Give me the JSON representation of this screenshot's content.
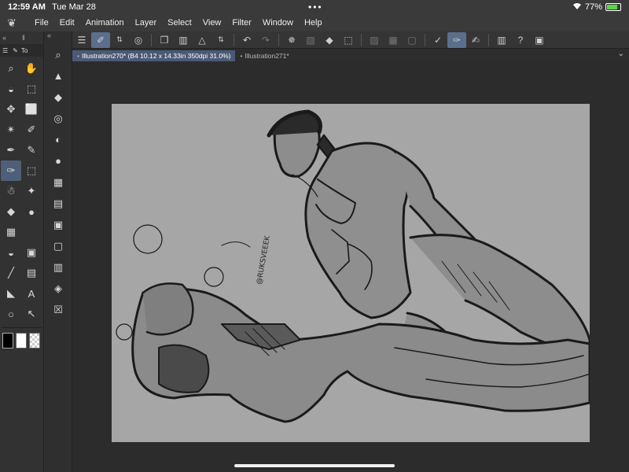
{
  "status": {
    "time": "12:59 AM",
    "date": "Tue Mar 28",
    "dots": "•••",
    "wifi_icon": "wifi-icon",
    "battery": "77%",
    "battery_level": 0.77
  },
  "menu": {
    "logo": "app-logo",
    "items": [
      "File",
      "Edit",
      "Animation",
      "Layer",
      "Select",
      "View",
      "Filter",
      "Window",
      "Help"
    ]
  },
  "toolbar": {
    "buttons": [
      "menu-icon",
      "brush-size-icon",
      "stepper-icon",
      "record-icon",
      "new-file-icon",
      "open-icon",
      "save-icon",
      "stepper-icon",
      "undo-icon",
      "redo-icon",
      "loading-icon",
      "transform-icon",
      "fill-icon",
      "crop-icon",
      "clear-icon",
      "layer-off-icon",
      "square-icon",
      "stroke-icon",
      "brush-icon",
      "pen-icon",
      "sidebar-icon",
      "help-icon",
      "settings-icon"
    ]
  },
  "tabs": {
    "items": [
      {
        "label": "Illustration270* (B4 10.12 x 14.33in 350dpi 31.0%)",
        "active": true
      },
      {
        "label": "Illustration271*",
        "active": false
      }
    ]
  },
  "left_panel": {
    "tab_label": "To",
    "tools": [
      {
        "icon": "zoom-icon",
        "glyph": "⌕"
      },
      {
        "icon": "hand-icon",
        "glyph": "✋"
      },
      {
        "icon": "fill-bucket-icon",
        "glyph": "◒"
      },
      {
        "icon": "object-select-icon",
        "glyph": "⬚"
      },
      {
        "icon": "move-icon",
        "glyph": "✥"
      },
      {
        "icon": "selection-rect-icon",
        "glyph": "⬜"
      },
      {
        "icon": "magic-wand-icon",
        "glyph": "✴"
      },
      {
        "icon": "eyedropper-icon",
        "glyph": "✐"
      },
      {
        "icon": "pen-icon",
        "glyph": "✒"
      },
      {
        "icon": "pencil-icon",
        "glyph": "✎"
      },
      {
        "icon": "brush-icon",
        "glyph": "✑"
      },
      {
        "icon": "marquee-icon",
        "glyph": "⬚"
      },
      {
        "icon": "airbrush-icon",
        "glyph": "☃"
      },
      {
        "icon": "sparkle-icon",
        "glyph": "✦"
      },
      {
        "icon": "eraser-icon",
        "glyph": "◆"
      },
      {
        "icon": "blend-icon",
        "glyph": "●"
      },
      {
        "icon": "frame-icon",
        "glyph": "▦"
      },
      {
        "icon": "empty-icon",
        "glyph": ""
      },
      {
        "icon": "fill-icon",
        "glyph": "◒"
      },
      {
        "icon": "gradient-icon",
        "glyph": "▣"
      },
      {
        "icon": "line-icon",
        "glyph": "╱"
      },
      {
        "icon": "panel-icon",
        "glyph": "▤"
      },
      {
        "icon": "ruler-icon",
        "glyph": "◣"
      },
      {
        "icon": "text-icon",
        "glyph": "A"
      },
      {
        "icon": "speech-bubble-icon",
        "glyph": "○"
      },
      {
        "icon": "operation-icon",
        "glyph": "↖"
      }
    ],
    "colors": [
      "#000000",
      "#ffffff",
      "checker"
    ]
  },
  "side_panel": {
    "tools": [
      "navigator-icon",
      "sub-tool-icon",
      "tool-property-icon",
      "brush-size-icon",
      "color-wheel-icon",
      "color-set-icon",
      "intermediate-color-icon",
      "approx-color-icon",
      "color-history-icon",
      "material-icon",
      "layer-property-icon",
      "layer-icon",
      "delete-icon"
    ]
  },
  "canvas": {
    "background": "#a6a6a6",
    "signature": "@RUKSVEEEK"
  }
}
